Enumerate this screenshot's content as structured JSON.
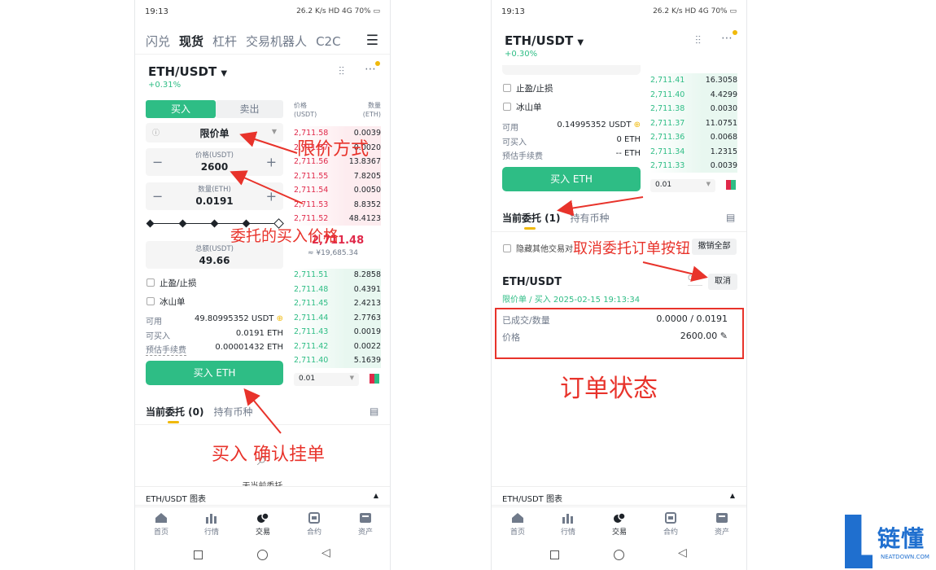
{
  "status": {
    "time": "19:13",
    "battery": "70%",
    "signal_icons": "26.2 K/s  HD 4G"
  },
  "phoneA": {
    "nav": [
      "闪兑",
      "现货",
      "杠杆",
      "交易机器人",
      "C2C"
    ],
    "nav_active": 1,
    "pair": "ETH/USDT",
    "change": "+0.31%",
    "buy_tab": "买入",
    "sell_tab": "卖出",
    "order_type": "限价单",
    "price_label": "价格(USDT)",
    "price_value": "2600",
    "qty_label": "数量(ETH)",
    "qty_value": "0.0191",
    "total_label": "总额(USDT)",
    "total_value": "49.66",
    "tp_sl": "止盈/止损",
    "iceberg": "冰山单",
    "avail_label": "可用",
    "avail_value": "49.80995352 USDT",
    "can_buy_label": "可买入",
    "can_buy_value": "0.0191 ETH",
    "fee_label": "预估手续费",
    "fee_value": "0.00001432 ETH",
    "buy_button": "买入 ETH",
    "ob_price_header": "价格\n(USDT)",
    "ob_qty_header": "数量\n(ETH)",
    "asks": [
      {
        "p": "2,711.58",
        "q": "0.0039"
      },
      {
        "p": "2,711.57",
        "q": "0.0020"
      },
      {
        "p": "2,711.56",
        "q": "13.8367"
      },
      {
        "p": "2,711.55",
        "q": "7.8205"
      },
      {
        "p": "2,711.54",
        "q": "0.0050"
      },
      {
        "p": "2,711.53",
        "q": "8.8352"
      },
      {
        "p": "2,711.52",
        "q": "48.4123"
      }
    ],
    "mid_price": "2,711.48",
    "mid_cny": "≈ ¥19,685.34",
    "bids": [
      {
        "p": "2,711.51",
        "q": "8.2858"
      },
      {
        "p": "2,711.48",
        "q": "0.4391"
      },
      {
        "p": "2,711.45",
        "q": "2.4213"
      },
      {
        "p": "2,711.44",
        "q": "2.7763"
      },
      {
        "p": "2,711.43",
        "q": "0.0019"
      },
      {
        "p": "2,711.42",
        "q": "0.0022"
      },
      {
        "p": "2,711.40",
        "q": "5.1639"
      }
    ],
    "depth_select": "0.01",
    "tab_orders": "当前委托 (0)",
    "tab_holdings": "持有币种",
    "empty_text": "无当前委托",
    "chart_bar": "ETH/USDT 图表"
  },
  "phoneB": {
    "pair": "ETH/USDT",
    "change": "+0.30%",
    "tp_sl": "止盈/止损",
    "iceberg": "冰山单",
    "avail_label": "可用",
    "avail_value": "0.14995352 USDT",
    "can_buy_label": "可买入",
    "can_buy_value": "0 ETH",
    "fee_label": "预估手续费",
    "fee_value": "-- ETH",
    "buy_button": "买入 ETH",
    "bids": [
      {
        "p": "2,711.41",
        "q": "16.3058"
      },
      {
        "p": "2,711.40",
        "q": "4.4299"
      },
      {
        "p": "2,711.38",
        "q": "0.0030"
      },
      {
        "p": "2,711.37",
        "q": "11.0751"
      },
      {
        "p": "2,711.36",
        "q": "0.0068"
      },
      {
        "p": "2,711.34",
        "q": "1.2315"
      },
      {
        "p": "2,711.33",
        "q": "0.0039"
      }
    ],
    "depth_select": "0.01",
    "tab_orders": "当前委托 (1)",
    "tab_holdings": "持有币种",
    "hide_other": "隐藏其他交易对",
    "cancel_all": "撤销全部",
    "order_pair": "ETH/USDT",
    "order_meta": "限价单 / 买入  2025-02-15 19:13:34",
    "cancel": "取消",
    "filled_label": "已成交/数量",
    "filled_value": "0.0000 / 0.0191",
    "price_label": "价格",
    "price_value": "2600.00",
    "chart_bar": "ETH/USDT 图表"
  },
  "tabbar": [
    "首页",
    "行情",
    "交易",
    "合约",
    "资产"
  ],
  "tabbar_active": 2,
  "annotations": {
    "limit": "限价方式",
    "price": "委托的买入价格",
    "confirm": "买入  确认挂单",
    "cancel_btn": "取消委托订单按钮",
    "status": "订单状态"
  },
  "logo": {
    "text": "链懂",
    "sub": "NEATDOWN.COM"
  },
  "colors": {
    "green": "#2ebd85",
    "red": "#e0294a",
    "annotation": "#e8332b",
    "accent": "#f0b90b"
  }
}
